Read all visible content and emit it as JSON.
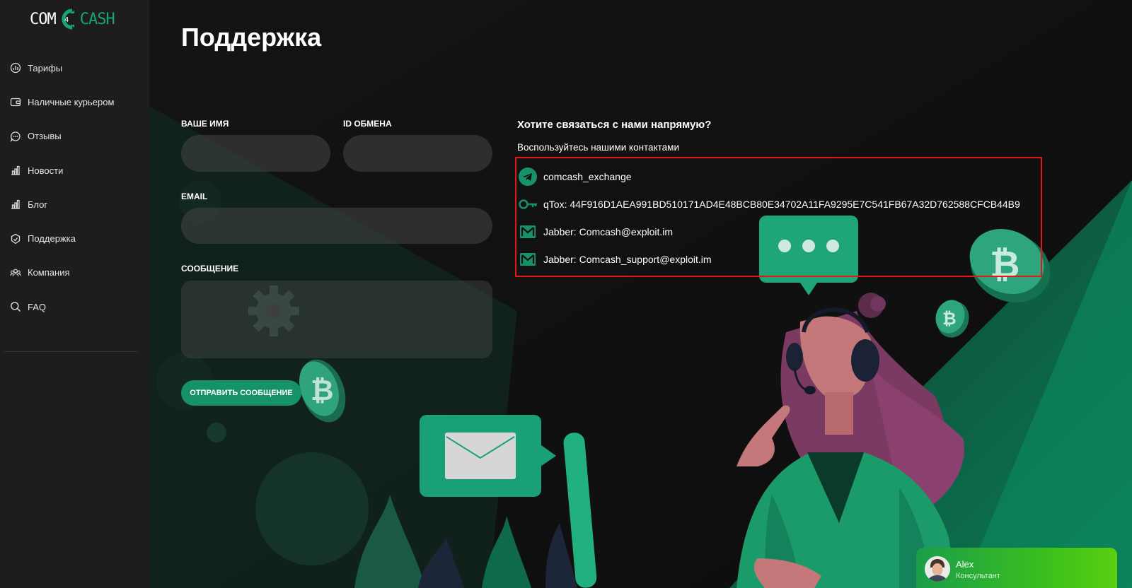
{
  "logo": {
    "left": "COM",
    "right": "CASH"
  },
  "sidebar": {
    "items": [
      {
        "label": "Тарифы",
        "icon": "tariffs-icon"
      },
      {
        "label": "Наличные курьером",
        "icon": "wallet-icon"
      },
      {
        "label": "Отзывы",
        "icon": "chat-bubble-icon"
      },
      {
        "label": "Новости",
        "icon": "bar-chart-icon"
      },
      {
        "label": "Блог",
        "icon": "bar-chart-icon"
      },
      {
        "label": "Поддержка",
        "icon": "support-icon"
      },
      {
        "label": "Компания",
        "icon": "people-icon"
      },
      {
        "label": "FAQ",
        "icon": "search-icon"
      }
    ]
  },
  "page": {
    "title": "Поддержка"
  },
  "form": {
    "name_label": "ВАШЕ ИМЯ",
    "exchange_id_label": "ID ОБМЕНА",
    "email_label": "EMAIL",
    "message_label": "СООБЩЕНИЕ",
    "submit_label": "ОТПРАВИТЬ СООБЩЕНИЕ"
  },
  "contacts": {
    "heading": "Хотите связаться с нами напрямую?",
    "subheading": "Воспользуйтесь нашими контактами",
    "items": [
      {
        "icon": "telegram-icon",
        "text": "comcash_exchange"
      },
      {
        "icon": "key-icon",
        "text": "qTox: 44F916D1AEA991BD510171AD4E48BCB80E34702A11FA9295E7C541FB67A32D762588CFCB44B9"
      },
      {
        "icon": "mail-icon",
        "text": "Jabber: Comcash@exploit.im"
      },
      {
        "icon": "mail-icon",
        "text": "Jabber: Comcash_support@exploit.im"
      }
    ]
  },
  "chat": {
    "name": "Alex",
    "role": "Консультант"
  },
  "colors": {
    "accent": "#17916a",
    "sidebar_bg": "#1d1d1d",
    "page_bg": "#0f0f0f",
    "highlight_border": "#e01818"
  }
}
